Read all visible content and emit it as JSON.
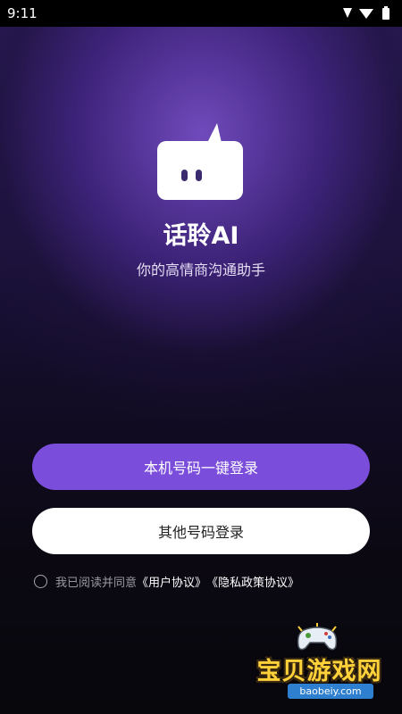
{
  "status_bar": {
    "time": "9:11"
  },
  "app": {
    "name": "话聆AI",
    "tagline": "你的高情商沟通助手"
  },
  "buttons": {
    "one_click_login": "本机号码一键登录",
    "other_number_login": "其他号码登录"
  },
  "agreement": {
    "prefix": "我已阅读并同意",
    "user_agreement": "《用户协议》",
    "privacy_policy": "《隐私政策协议》",
    "checked": false
  },
  "watermark": {
    "brand": "宝贝游戏网",
    "url": "baobeiy.com"
  },
  "colors": {
    "primary_button": "#7b4ddb",
    "secondary_button": "#ffffff",
    "background_top": "#2a1a56",
    "background_bottom": "#08070c"
  }
}
